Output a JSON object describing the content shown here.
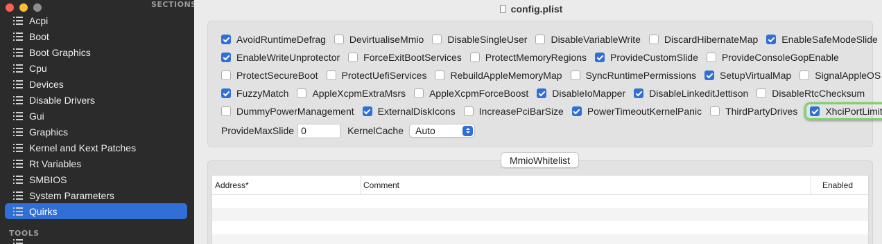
{
  "sidebar": {
    "sections_header": "SECTIONS",
    "items": [
      {
        "label": "Acpi"
      },
      {
        "label": "Boot"
      },
      {
        "label": "Boot Graphics"
      },
      {
        "label": "Cpu"
      },
      {
        "label": "Devices"
      },
      {
        "label": "Disable Drivers"
      },
      {
        "label": "Gui"
      },
      {
        "label": "Graphics"
      },
      {
        "label": "Kernel and Kext Patches"
      },
      {
        "label": "Rt Variables"
      },
      {
        "label": "SMBIOS"
      },
      {
        "label": "System Parameters"
      },
      {
        "label": "Quirks"
      }
    ],
    "selected": "Quirks",
    "tools_header": "TOOLS"
  },
  "window": {
    "title": "config.plist"
  },
  "quirks": {
    "rows": [
      [
        {
          "label": "AvoidRuntimeDefrag",
          "checked": true
        },
        {
          "label": "DevirtualiseMmio",
          "checked": false
        },
        {
          "label": "DisableSingleUser",
          "checked": false
        },
        {
          "label": "DisableVariableWrite",
          "checked": false
        },
        {
          "label": "DiscardHibernateMap",
          "checked": false
        },
        {
          "label": "EnableSafeModeSlide",
          "checked": true
        }
      ],
      [
        {
          "label": "EnableWriteUnprotector",
          "checked": true
        },
        {
          "label": "ForceExitBootServices",
          "checked": false
        },
        {
          "label": "ProtectMemoryRegions",
          "checked": false
        },
        {
          "label": "ProvideCustomSlide",
          "checked": true
        },
        {
          "label": "ProvideConsoleGopEnable",
          "checked": false
        }
      ],
      [
        {
          "label": "ProtectSecureBoot",
          "checked": false
        },
        {
          "label": "ProtectUefiServices",
          "checked": false
        },
        {
          "label": "RebuildAppleMemoryMap",
          "checked": false
        },
        {
          "label": "SyncRuntimePermissions",
          "checked": false
        },
        {
          "label": "SetupVirtualMap",
          "checked": true
        },
        {
          "label": "SignalAppleOS",
          "checked": false
        }
      ],
      [
        {
          "label": "FuzzyMatch",
          "checked": true
        },
        {
          "label": "AppleXcpmExtraMsrs",
          "checked": false
        },
        {
          "label": "AppleXcpmForceBoost",
          "checked": false
        },
        {
          "label": "DisableIoMapper",
          "checked": true
        },
        {
          "label": "DisableLinkeditJettison",
          "checked": true
        },
        {
          "label": "DisableRtcChecksum",
          "checked": false
        }
      ],
      [
        {
          "label": "DummyPowerManagement",
          "checked": false
        },
        {
          "label": "ExternalDiskIcons",
          "checked": true
        },
        {
          "label": "IncreasePciBarSize",
          "checked": false
        },
        {
          "label": "PowerTimeoutKernelPanic",
          "checked": true
        },
        {
          "label": "ThirdPartyDrives",
          "checked": false
        },
        {
          "label": "XhciPortLimit",
          "checked": true,
          "highlighted": true
        }
      ]
    ],
    "provide_max_slide_label": "ProvideMaxSlide",
    "provide_max_slide_value": "0",
    "kernel_cache_label": "KernelCache",
    "kernel_cache_value": "Auto"
  },
  "mmio": {
    "button_label": "MmioWhitelist",
    "columns": [
      "Address*",
      "Comment",
      "Enabled"
    ],
    "rows": []
  },
  "colors": {
    "accent": "#2f6fd6",
    "highlight_ring": "#7bd36a",
    "sidebar_bg": "#2b2b2b"
  }
}
